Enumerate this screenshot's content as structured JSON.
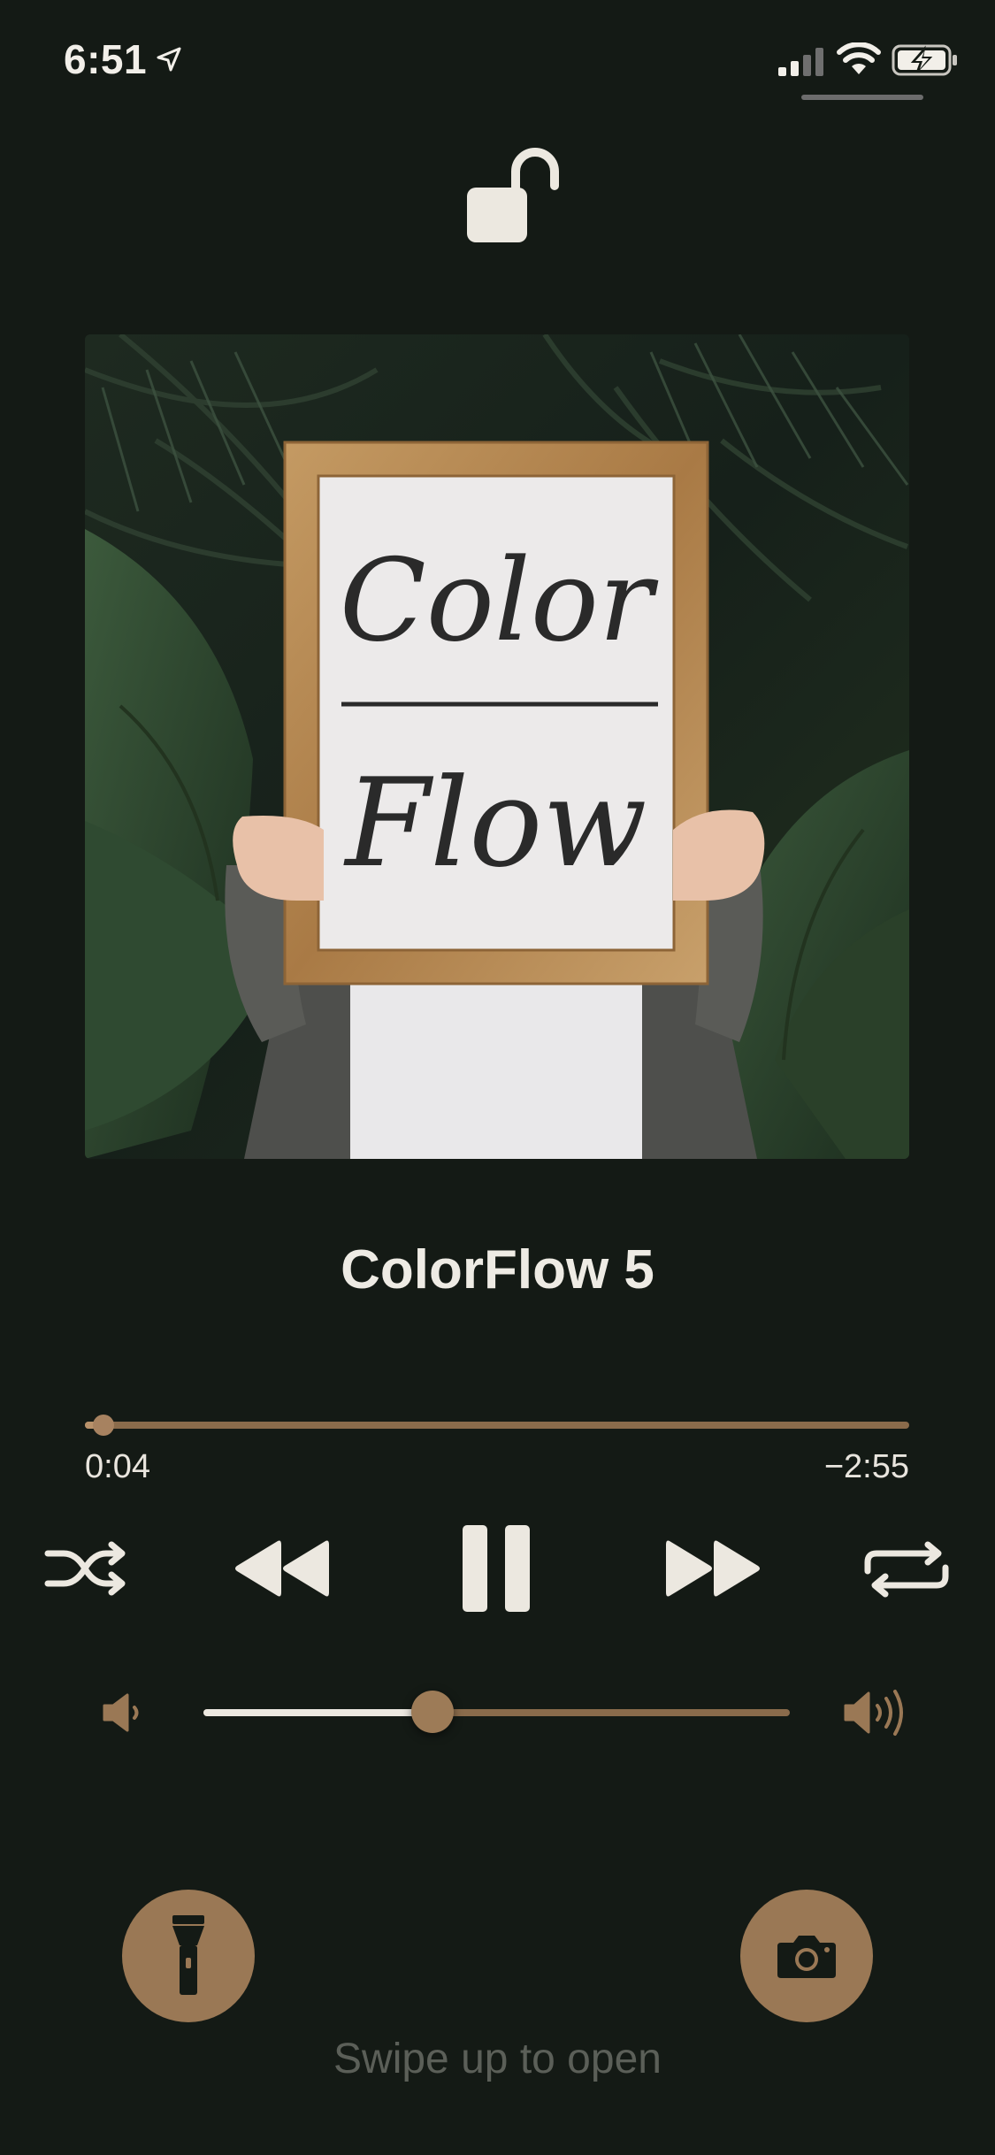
{
  "status_bar": {
    "time": "6:51",
    "location_icon": "location-arrow-icon",
    "signal_icon": "cellular-signal-icon",
    "wifi_icon": "wifi-icon",
    "battery_icon": "battery-charging-icon"
  },
  "lock": {
    "icon": "unlocked-padlock-icon"
  },
  "artwork": {
    "sign_line1": "Color",
    "sign_line2": "Flow"
  },
  "now_playing": {
    "title": "ColorFlow 5",
    "elapsed": "0:04",
    "remaining": "−2:55",
    "progress_fraction": 0.022
  },
  "controls": {
    "shuffle_icon": "shuffle-icon",
    "rewind_icon": "rewind-icon",
    "pause_icon": "pause-icon",
    "forward_icon": "fast-forward-icon",
    "repeat_icon": "repeat-icon"
  },
  "volume": {
    "level_fraction": 0.39,
    "low_icon": "volume-low-icon",
    "high_icon": "volume-high-icon"
  },
  "bottom": {
    "flashlight_icon": "flashlight-icon",
    "camera_icon": "camera-icon",
    "swipe_hint": "Swipe up to open"
  },
  "colors": {
    "background": "#141a15",
    "accent": "#9a7855",
    "text": "#ece8e0"
  }
}
